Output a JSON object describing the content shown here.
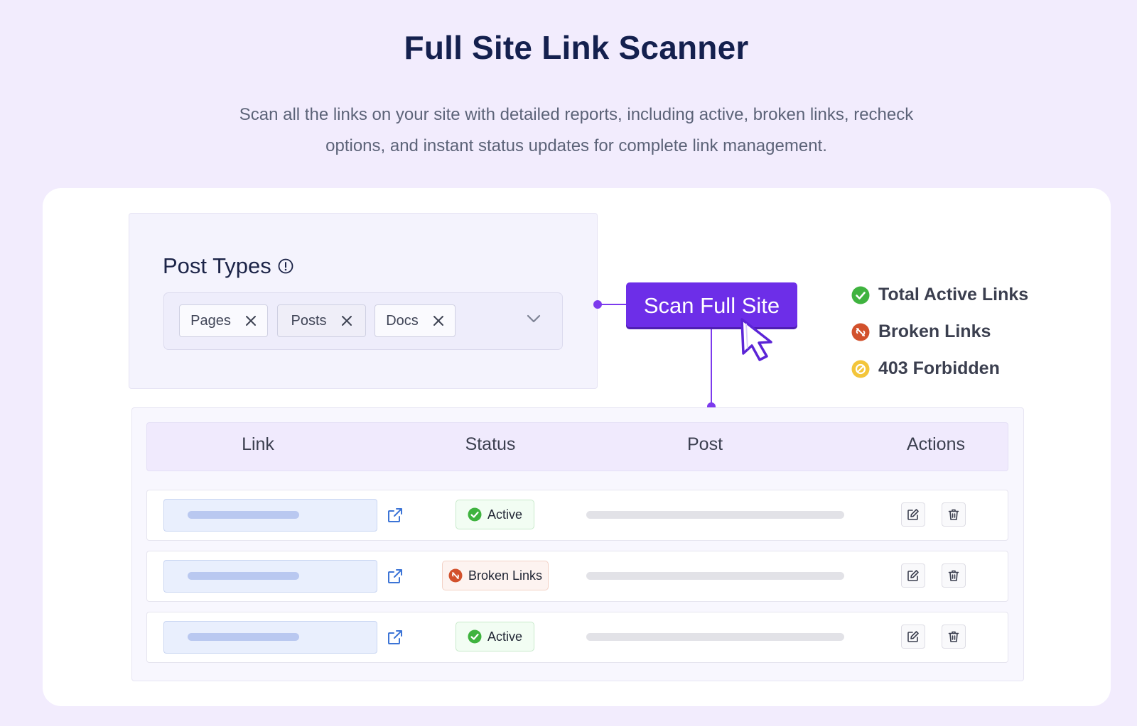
{
  "header": {
    "title": "Full Site Link Scanner",
    "description": "Scan all the links on your site with detailed reports, including active, broken links, recheck options, and instant status updates for complete link management."
  },
  "post_types": {
    "label": "Post Types",
    "chips": [
      {
        "label": "Pages"
      },
      {
        "label": "Posts"
      },
      {
        "label": "Docs"
      }
    ]
  },
  "scan_button": {
    "label": "Scan Full Site"
  },
  "legend": [
    {
      "label": "Total Active Links",
      "icon": "check-circle-icon",
      "color": "#3fb33f"
    },
    {
      "label": "Broken Links",
      "icon": "broken-link-icon",
      "color": "#d2512c"
    },
    {
      "label": "403 Forbidden",
      "icon": "forbidden-icon",
      "color": "#f3c53a"
    }
  ],
  "table": {
    "columns": [
      "Link",
      "Status",
      "Post",
      "Actions"
    ],
    "rows": [
      {
        "status": "Active"
      },
      {
        "status": "Broken Links"
      },
      {
        "status": "Active"
      }
    ]
  },
  "colors": {
    "accent": "#6d2ee8",
    "background": "#f2ecfd",
    "active": "#3fb33f",
    "broken": "#d2512c",
    "forbidden": "#f3c53a"
  }
}
